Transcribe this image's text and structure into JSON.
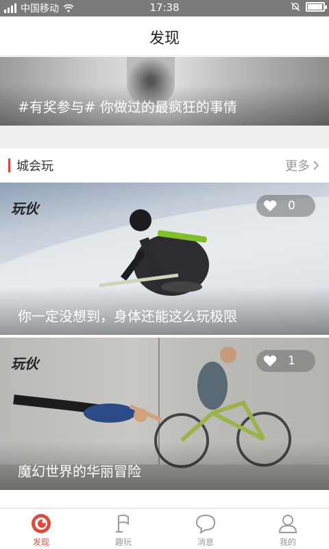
{
  "status_bar": {
    "carrier": "中国移动",
    "time": "17:38",
    "battery_level": 0.95
  },
  "header": {
    "title": "发现"
  },
  "banner": {
    "text": "#有奖参与# 你做过的最疯狂的事情"
  },
  "section": {
    "title": "城会玩",
    "more_label": "更多"
  },
  "cards": [
    {
      "logo": "玩伙",
      "likes": "0",
      "caption": "你一定没想到，身体还能这么玩极限"
    },
    {
      "logo": "玩伙",
      "likes": "1",
      "caption": "魔幻世界的华丽冒险"
    }
  ],
  "tabs": [
    {
      "label": "发现",
      "icon": "discover-icon",
      "active": true
    },
    {
      "label": "趣玩",
      "icon": "flag-icon",
      "active": false
    },
    {
      "label": "消息",
      "icon": "message-icon",
      "active": false
    },
    {
      "label": "我的",
      "icon": "profile-icon",
      "active": false
    }
  ],
  "colors": {
    "accent": "#e04a3a",
    "section_bar": "#e0443a"
  }
}
